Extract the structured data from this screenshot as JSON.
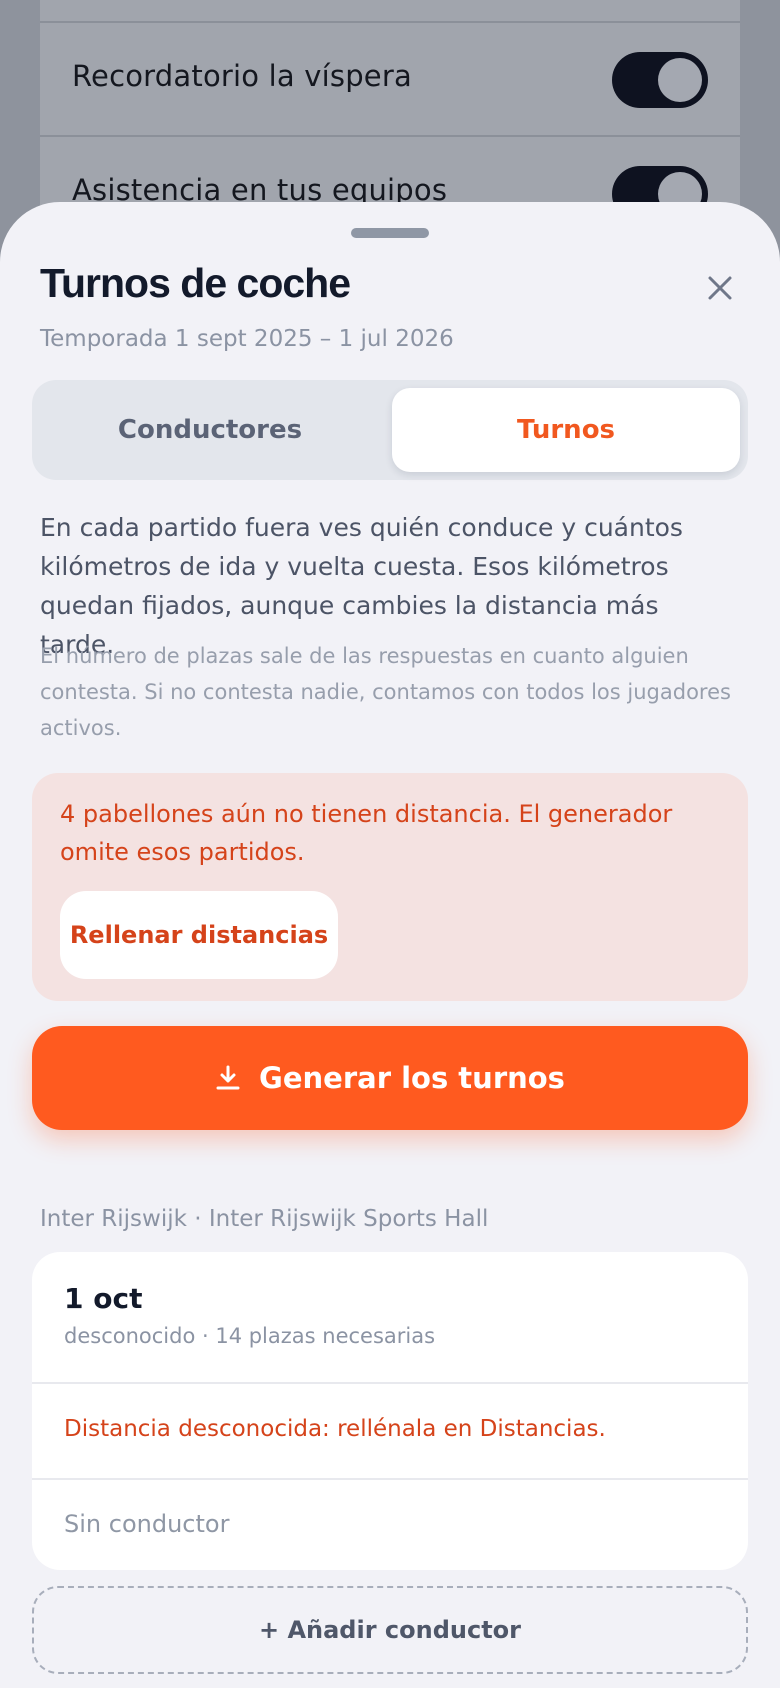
{
  "background": {
    "rows": [
      {
        "label": "Recordatorio la víspera",
        "toggle_on": true
      },
      {
        "label": "Asistencia en tus equipos",
        "toggle_on": true
      }
    ]
  },
  "sheet": {
    "title": "Turnos de coche",
    "subtitle": "Temporada 1 sept 2025 – 1 jul 2026",
    "close_icon": "close-icon",
    "tabs": [
      {
        "label": "Conductores",
        "selected": false
      },
      {
        "label": "Turnos",
        "selected": true
      }
    ],
    "description": "En cada partido fuera ves quién conduce y cuántos kilómetros de ida y vuelta cuesta. Esos kilómetros quedan fijados, aunque cambies la distancia más tarde.",
    "note": "El número de plazas sale de las respuestas en cuanto alguien contesta. Si no contesta nadie, contamos con todos los jugadores activos.",
    "warning": {
      "text": "4 pabellones aún no tienen distancia. El generador omite esos partidos.",
      "button": "Rellenar distancias"
    },
    "generate_button": {
      "label": "Generar los turnos",
      "icon": "download-icon"
    },
    "section_label": "Inter Rijswijk · Inter Rijswijk Sports Hall",
    "match": {
      "date": "1 oct",
      "meta": "desconocido · 14 plazas necesarias",
      "distance_warning": "Distancia desconocida: rellénala en Distancias.",
      "driver": "Sin conductor"
    },
    "add_driver_button": "+ Añadir conductor"
  },
  "colors": {
    "accent": "#ff5a1f",
    "warning_text": "#d5431a",
    "warning_bg": "#f4e2e1",
    "title": "#131a2b"
  }
}
